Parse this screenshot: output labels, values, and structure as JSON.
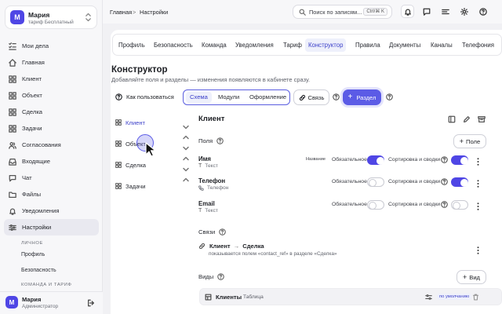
{
  "user": {
    "initial": "М",
    "name": "Мария",
    "plan": "тариф Бесплатный",
    "role": "Администратор"
  },
  "nav": {
    "items": [
      {
        "label": "Мои дела",
        "icon": "checklist-icon"
      },
      {
        "label": "Главная",
        "icon": "home-icon"
      },
      {
        "label": "Клиент",
        "icon": "grid-icon"
      },
      {
        "label": "Объект",
        "icon": "grid-icon"
      },
      {
        "label": "Сделка",
        "icon": "grid-icon"
      },
      {
        "label": "Задачи",
        "icon": "grid-icon"
      },
      {
        "label": "Согласования",
        "icon": "users-icon"
      },
      {
        "label": "Входящие",
        "icon": "inbox-icon"
      },
      {
        "label": "Чат",
        "icon": "chat-icon"
      },
      {
        "label": "Файлы",
        "icon": "folder-icon"
      },
      {
        "label": "Уведомления",
        "icon": "bell-icon"
      },
      {
        "label": "Настройки",
        "icon": "sliders-icon"
      }
    ],
    "section_personal": "ЛИЧНОЕ",
    "sub_profile": "Профиль",
    "sub_security": "Безопасность",
    "section_team": "КОМАНДА И ТАРИФ"
  },
  "topbar": {
    "crumb_home": "Главная",
    "crumb_sep": ">",
    "crumb_current": "Настройки",
    "search_placeholder": "Поиск по записям...",
    "search_shortcut": "Ctrl/⌘ K"
  },
  "tabs": [
    {
      "label": "Профиль"
    },
    {
      "label": "Безопасность"
    },
    {
      "label": "Команда"
    },
    {
      "label": "Уведомления"
    },
    {
      "label": "Тариф"
    },
    {
      "label": "Конструктор",
      "active": true
    },
    {
      "label": "Правила"
    },
    {
      "label": "Документы"
    },
    {
      "label": "Каналы"
    },
    {
      "label": "Телефония"
    }
  ],
  "builder": {
    "title": "Конструктор",
    "description": "Добавляйте поля и разделы — изменения появляются в кабинете сразу.",
    "howto": "Как пользоваться",
    "seg": {
      "schema": "Схема",
      "modules": "Модули",
      "design": "Оформление"
    },
    "link_button": "Связь",
    "section_button": "Раздел",
    "entities": [
      {
        "label": "Клиент",
        "active": true
      },
      {
        "label": "Объект"
      },
      {
        "label": "Сделка"
      },
      {
        "label": "Задачи"
      }
    ]
  },
  "detail": {
    "title": "Клиент",
    "fields_title": "Поля",
    "add_field": "Поле",
    "label_required": "Обязательное",
    "label_sort": "Сортировка и сводки",
    "label_name_tag": "Название",
    "type_glyph": "T",
    "fields": [
      {
        "name": "Имя",
        "type": "Текст",
        "required": true,
        "sort": true,
        "is_title": true
      },
      {
        "name": "Телефон",
        "type": "Телефон",
        "required": false,
        "sort": true
      },
      {
        "name": "Email",
        "type": "Текст",
        "required": false,
        "sort": false
      }
    ],
    "links_title": "Связи",
    "relation": {
      "from": "Клиент",
      "arrow": "→",
      "to": "Сделка",
      "subtitle": "показывается полем «contact_ref» в разделе «Сделка»"
    },
    "views_title": "Виды",
    "add_view": "Вид",
    "views": [
      {
        "name": "Клиенты",
        "type": "Таблица",
        "badge": "по умолчанию"
      }
    ]
  },
  "colors": {
    "accent": "#5b5be6",
    "toggle_on": "#4f46e5",
    "active_tab": "#3b3fc9"
  }
}
